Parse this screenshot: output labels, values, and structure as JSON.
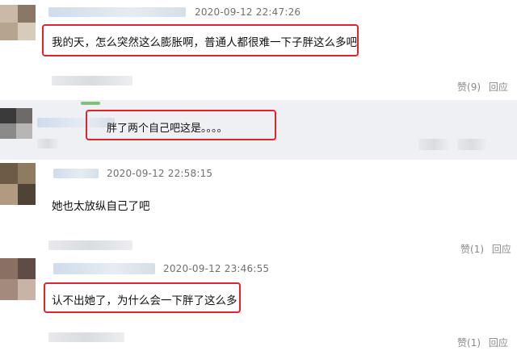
{
  "comments": [
    {
      "timestamp": "2020-09-12 22:47:26",
      "text": "我的天，怎么突然这么膨胀啊，普通人都很难一下子胖这么多吧",
      "like_label": "赞",
      "like_count": "(9)",
      "reply_label": "回应"
    },
    {
      "timestamp": "",
      "text": "胖了两个自己吧这是。。。。"
    },
    {
      "timestamp": "2020-09-12 22:58:15",
      "text": "她也太放纵自己了吧",
      "like_label": "赞",
      "like_count": "(1)",
      "reply_label": "回应"
    },
    {
      "timestamp": "2020-09-12 23:46:55",
      "text": "认不出她了，为什么会一下胖了这么多",
      "like_label": "赞",
      "like_count": "(1)",
      "reply_label": "回应"
    }
  ],
  "colors": {
    "highlight": "#e2242a",
    "reply_bg": "#eff0f4"
  }
}
